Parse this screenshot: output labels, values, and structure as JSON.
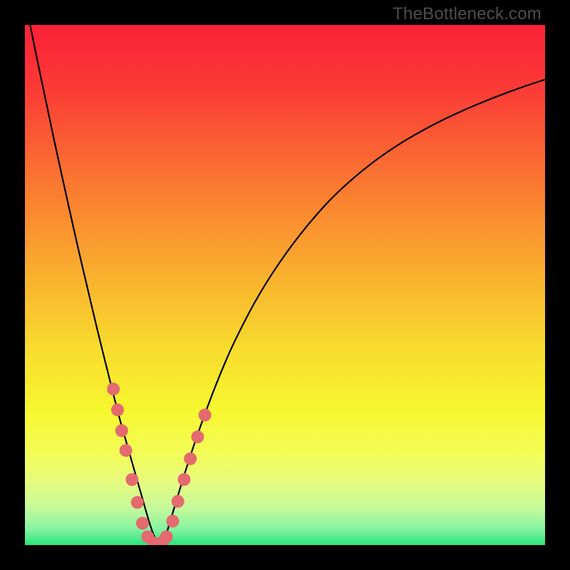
{
  "watermark": "TheBottleneck.com",
  "colors": {
    "frame": "#000000",
    "curve": "#000000",
    "marker_fill": "#e46a6f",
    "marker_stroke": "#d64a52",
    "gradient_stops": [
      {
        "offset": 0.0,
        "color": "#fb2238"
      },
      {
        "offset": 0.12,
        "color": "#fb3a36"
      },
      {
        "offset": 0.3,
        "color": "#fa7631"
      },
      {
        "offset": 0.48,
        "color": "#f9b02e"
      },
      {
        "offset": 0.62,
        "color": "#f8db2e"
      },
      {
        "offset": 0.74,
        "color": "#f6f72f"
      },
      {
        "offset": 0.82,
        "color": "#f4fc55"
      },
      {
        "offset": 0.88,
        "color": "#e6fb7f"
      },
      {
        "offset": 0.93,
        "color": "#c4f99b"
      },
      {
        "offset": 0.97,
        "color": "#83f39f"
      },
      {
        "offset": 1.0,
        "color": "#28e57f"
      }
    ]
  },
  "chart_data": {
    "type": "line",
    "title": "",
    "xlabel": "",
    "ylabel": "",
    "xlim": [
      0,
      100
    ],
    "ylim": [
      0,
      100
    ],
    "series": [
      {
        "name": "bottleneck-curve",
        "x": [
          0,
          2,
          4,
          6,
          8,
          10,
          12,
          14,
          16,
          18,
          19,
          20,
          21,
          22,
          23,
          24,
          25,
          26,
          27,
          28,
          30,
          32,
          34,
          36,
          38,
          40,
          44,
          48,
          52,
          56,
          60,
          66,
          72,
          78,
          84,
          90,
          96,
          100
        ],
        "y": [
          105,
          95,
          85.5,
          76,
          67,
          58,
          49.5,
          41,
          33,
          25,
          21.5,
          18,
          14.5,
          11,
          7.5,
          4,
          1.2,
          0.2,
          1.5,
          4.8,
          11.5,
          17.8,
          23.6,
          29,
          34,
          38.6,
          46.5,
          53,
          58.6,
          63.5,
          67.8,
          73,
          77.2,
          80.6,
          83.5,
          86,
          88.2,
          89.5
        ]
      }
    ],
    "markers": [
      {
        "name": "left-cluster",
        "points": [
          {
            "x": 17.0,
            "y": 30.0
          },
          {
            "x": 17.8,
            "y": 26.0
          },
          {
            "x": 18.6,
            "y": 22.0
          },
          {
            "x": 19.4,
            "y": 18.2
          },
          {
            "x": 20.6,
            "y": 12.6
          },
          {
            "x": 21.6,
            "y": 8.2
          },
          {
            "x": 22.6,
            "y": 4.2
          },
          {
            "x": 23.6,
            "y": 1.6
          }
        ]
      },
      {
        "name": "valley-cluster",
        "points": [
          {
            "x": 24.8,
            "y": 0.4
          },
          {
            "x": 25.6,
            "y": 0.2
          },
          {
            "x": 26.4,
            "y": 0.5
          },
          {
            "x": 27.2,
            "y": 1.6
          }
        ]
      },
      {
        "name": "right-cluster",
        "points": [
          {
            "x": 28.4,
            "y": 4.6
          },
          {
            "x": 29.4,
            "y": 8.4
          },
          {
            "x": 30.6,
            "y": 12.6
          },
          {
            "x": 31.8,
            "y": 16.6
          },
          {
            "x": 33.2,
            "y": 20.8
          },
          {
            "x": 34.6,
            "y": 25.0
          }
        ]
      }
    ]
  }
}
